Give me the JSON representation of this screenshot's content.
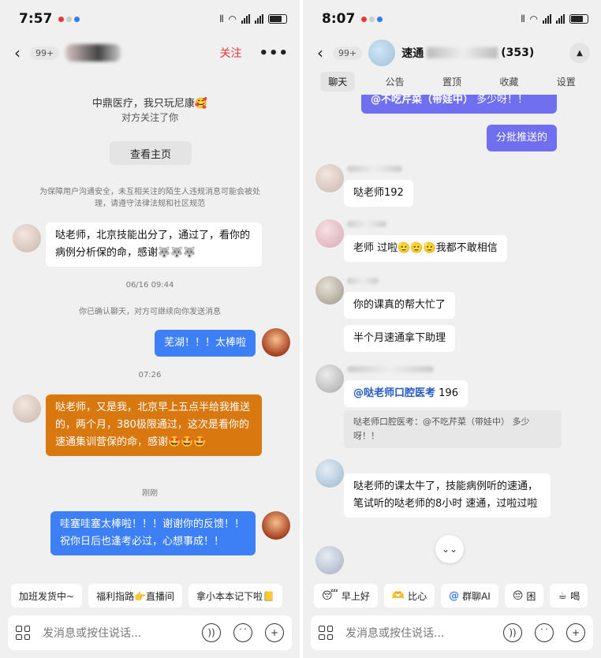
{
  "left": {
    "status": {
      "time": "7:57"
    },
    "header": {
      "back": "‹",
      "badge": "99+",
      "follow": "关注",
      "more": "•••"
    },
    "intro": {
      "line1": "中鼎医疗，我只玩尼康🥰",
      "line2": "对方关注了你",
      "profile_button": "查看主页",
      "notice": "为保障用户沟通安全，未互相关注的陌生人违规消息可能会被处理，请遵守法律法规和社区规范"
    },
    "messages": [
      {
        "text": "哒老师，北京技能出分了，通过了，看你的病例分析保的命，感谢🐺🐺🐺"
      },
      {
        "text": "06/16 09:44"
      },
      {
        "text": "你已确认聊天，对方可继续向你发送消息"
      },
      {
        "text": "芜湖！！！太棒啦"
      },
      {
        "text": "07:26"
      },
      {
        "text": "哒老师，又是我，北京早上五点半给我推送的，两个月，380极限通过，这次是看你的速通集训营保的命，感谢🤩🤩🤩"
      },
      {
        "text": "刚刚"
      },
      {
        "text": "哇塞哇塞太棒啦！！！谢谢你的反馈！！祝你日后也逢考必过，心想事成！！"
      }
    ],
    "quick": [
      "加班发货中~",
      "福利指路👉直播间",
      "拿小本本记下啦📒"
    ],
    "input": {
      "placeholder": "发消息或按住说话..."
    }
  },
  "right": {
    "status": {
      "time": "8:07"
    },
    "header": {
      "back": "‹",
      "badge": "99+",
      "title": "速通",
      "count": "(353)",
      "collapse": "▲"
    },
    "tabs": [
      "聊天",
      "公告",
      "置顶",
      "收藏",
      "设置"
    ],
    "messages": [
      {
        "mention": "@不吃芹菜（带娃中）",
        "text": " 多少呀！！"
      },
      {
        "text": "分批推送的"
      },
      {
        "text": "哒老师192"
      },
      {
        "text": "老师 过啦🫡🫡🫡我都不敢相信"
      },
      {
        "text": "你的课真的帮大忙了"
      },
      {
        "text": "半个月速通拿下助理"
      },
      {
        "mention": "@哒老师口腔医考",
        "text": " 196"
      },
      {
        "text": "哒老师口腔医考：@不吃芹菜（带娃中） 多少呀！！"
      },
      {
        "text": "哒老师的课太牛了，技能病例听的速通，笔试听的哒老师的8小时 速通，过啦过啦"
      }
    ],
    "scroll": "⌄⌄",
    "quick": [
      {
        "icon": "😴",
        "label": "早上好"
      },
      {
        "icon": "🫶",
        "label": "比心"
      },
      {
        "icon": "@",
        "label": "群聊AI"
      },
      {
        "icon": "😔",
        "label": "困"
      },
      {
        "icon": "☕",
        "label": "喝"
      }
    ],
    "input": {
      "placeholder": "发消息或按住说话..."
    }
  },
  "colors": {
    "blue": "#3d7ff5",
    "purple": "#6f6ff0",
    "orange": "#d9780f",
    "follow": "#e53935"
  },
  "icons": {
    "voice": "voice-icon",
    "emoji": "emoji-icon",
    "plus": "plus-icon",
    "apps": "apps-grid-icon"
  }
}
